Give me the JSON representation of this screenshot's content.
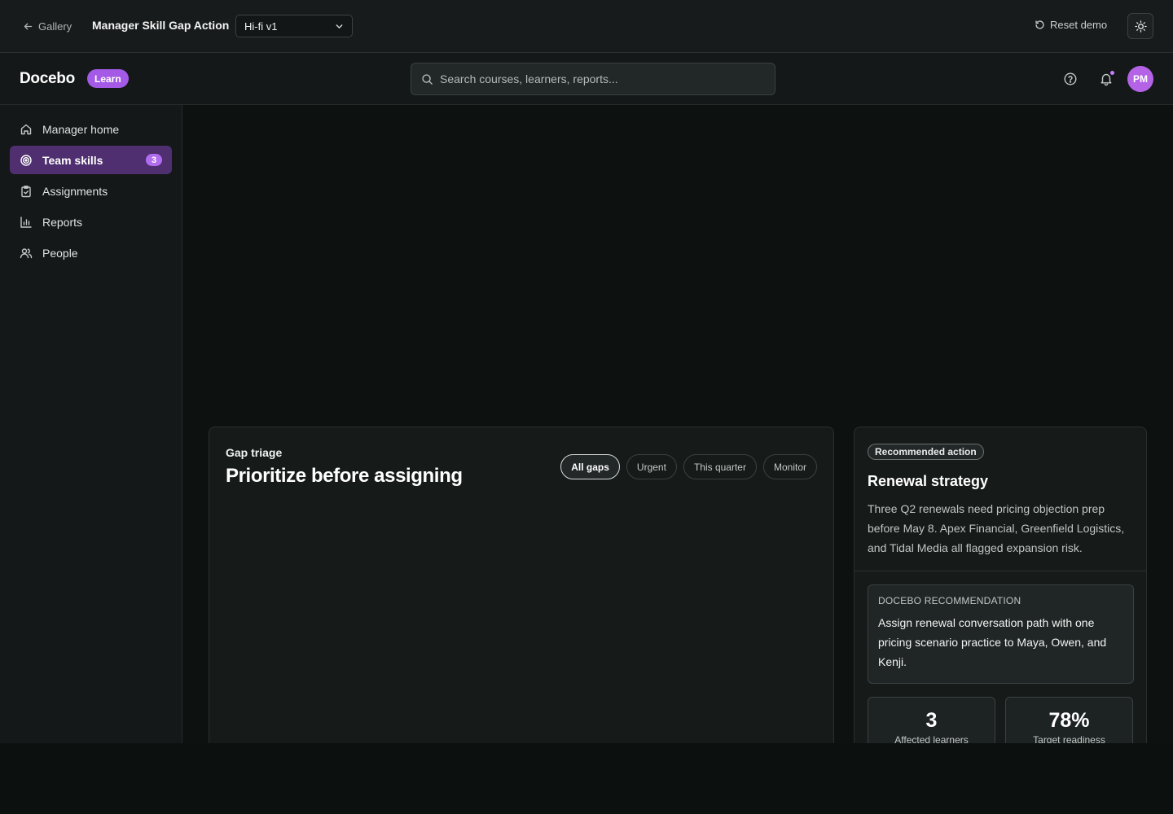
{
  "demobar": {
    "back_label": "Gallery",
    "title": "Manager Skill Gap Action",
    "version": "Hi-fi v1",
    "reset_label": "Reset demo"
  },
  "header": {
    "brand": "Docebo",
    "badge": "Learn",
    "search_placeholder": "Search courses, learners, reports...",
    "avatar_initials": "PM"
  },
  "sidebar": {
    "items": [
      {
        "label": "Manager home",
        "icon": "home-icon"
      },
      {
        "label": "Team skills",
        "icon": "target-icon",
        "count": "3",
        "active": true
      },
      {
        "label": "Assignments",
        "icon": "clipboard-icon"
      },
      {
        "label": "Reports",
        "icon": "bar-chart-icon"
      },
      {
        "label": "People",
        "icon": "users-icon"
      }
    ]
  },
  "triage": {
    "eyebrow": "Gap triage",
    "title": "Prioritize before assigning",
    "filters": [
      "All gaps",
      "Urgent",
      "This quarter",
      "Monitor"
    ],
    "active_filter": "All gaps"
  },
  "recommendation": {
    "badge": "Recommended action",
    "title": "Renewal strategy",
    "description": "Three Q2 renewals need pricing objection prep before May 8. Apex Financial, Greenfield Logistics, and Tidal Media all flagged expansion risk.",
    "box_eyebrow": "DOCEBO RECOMMENDATION",
    "box_text": "Assign renewal conversation path with one pricing scenario practice to Maya, Owen, and Kenji.",
    "stats": [
      {
        "value": "3",
        "label": "Affected learners"
      },
      {
        "value": "78%",
        "label": "Target readiness"
      }
    ]
  },
  "colors": {
    "accent": "#b26cf0",
    "active_nav_bg": "#4f2f6f",
    "background": "#0d1110"
  }
}
